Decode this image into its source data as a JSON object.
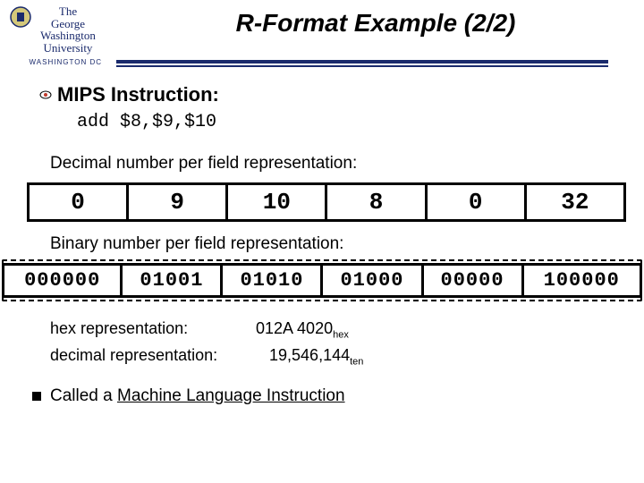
{
  "logo": {
    "line1": "The",
    "line2": "George",
    "line3": "Washington",
    "line4": "University",
    "sub": "WASHINGTON DC"
  },
  "title": "R-Format Example (2/2)",
  "heading": {
    "bold": "MIPS Instruction:",
    "code": "add  $8,$9,$10"
  },
  "decimal_caption": "Decimal number per field representation:",
  "decimal_fields": [
    "0",
    "9",
    "10",
    "8",
    "0",
    "32"
  ],
  "binary_caption": "Binary number per field representation:",
  "binary_fields": [
    "000000",
    "01001",
    "01010",
    "01000",
    "00000",
    "100000"
  ],
  "hex_trailing": "hex",
  "hex_rep": {
    "label": "hex representation:",
    "value": "012A 4020",
    "sub": "hex"
  },
  "dec_rep": {
    "label": "decimal representation:",
    "value": "19,546,144",
    "sub": "ten"
  },
  "final": {
    "prefix": "Called a ",
    "link": "Machine Language Instruction"
  }
}
